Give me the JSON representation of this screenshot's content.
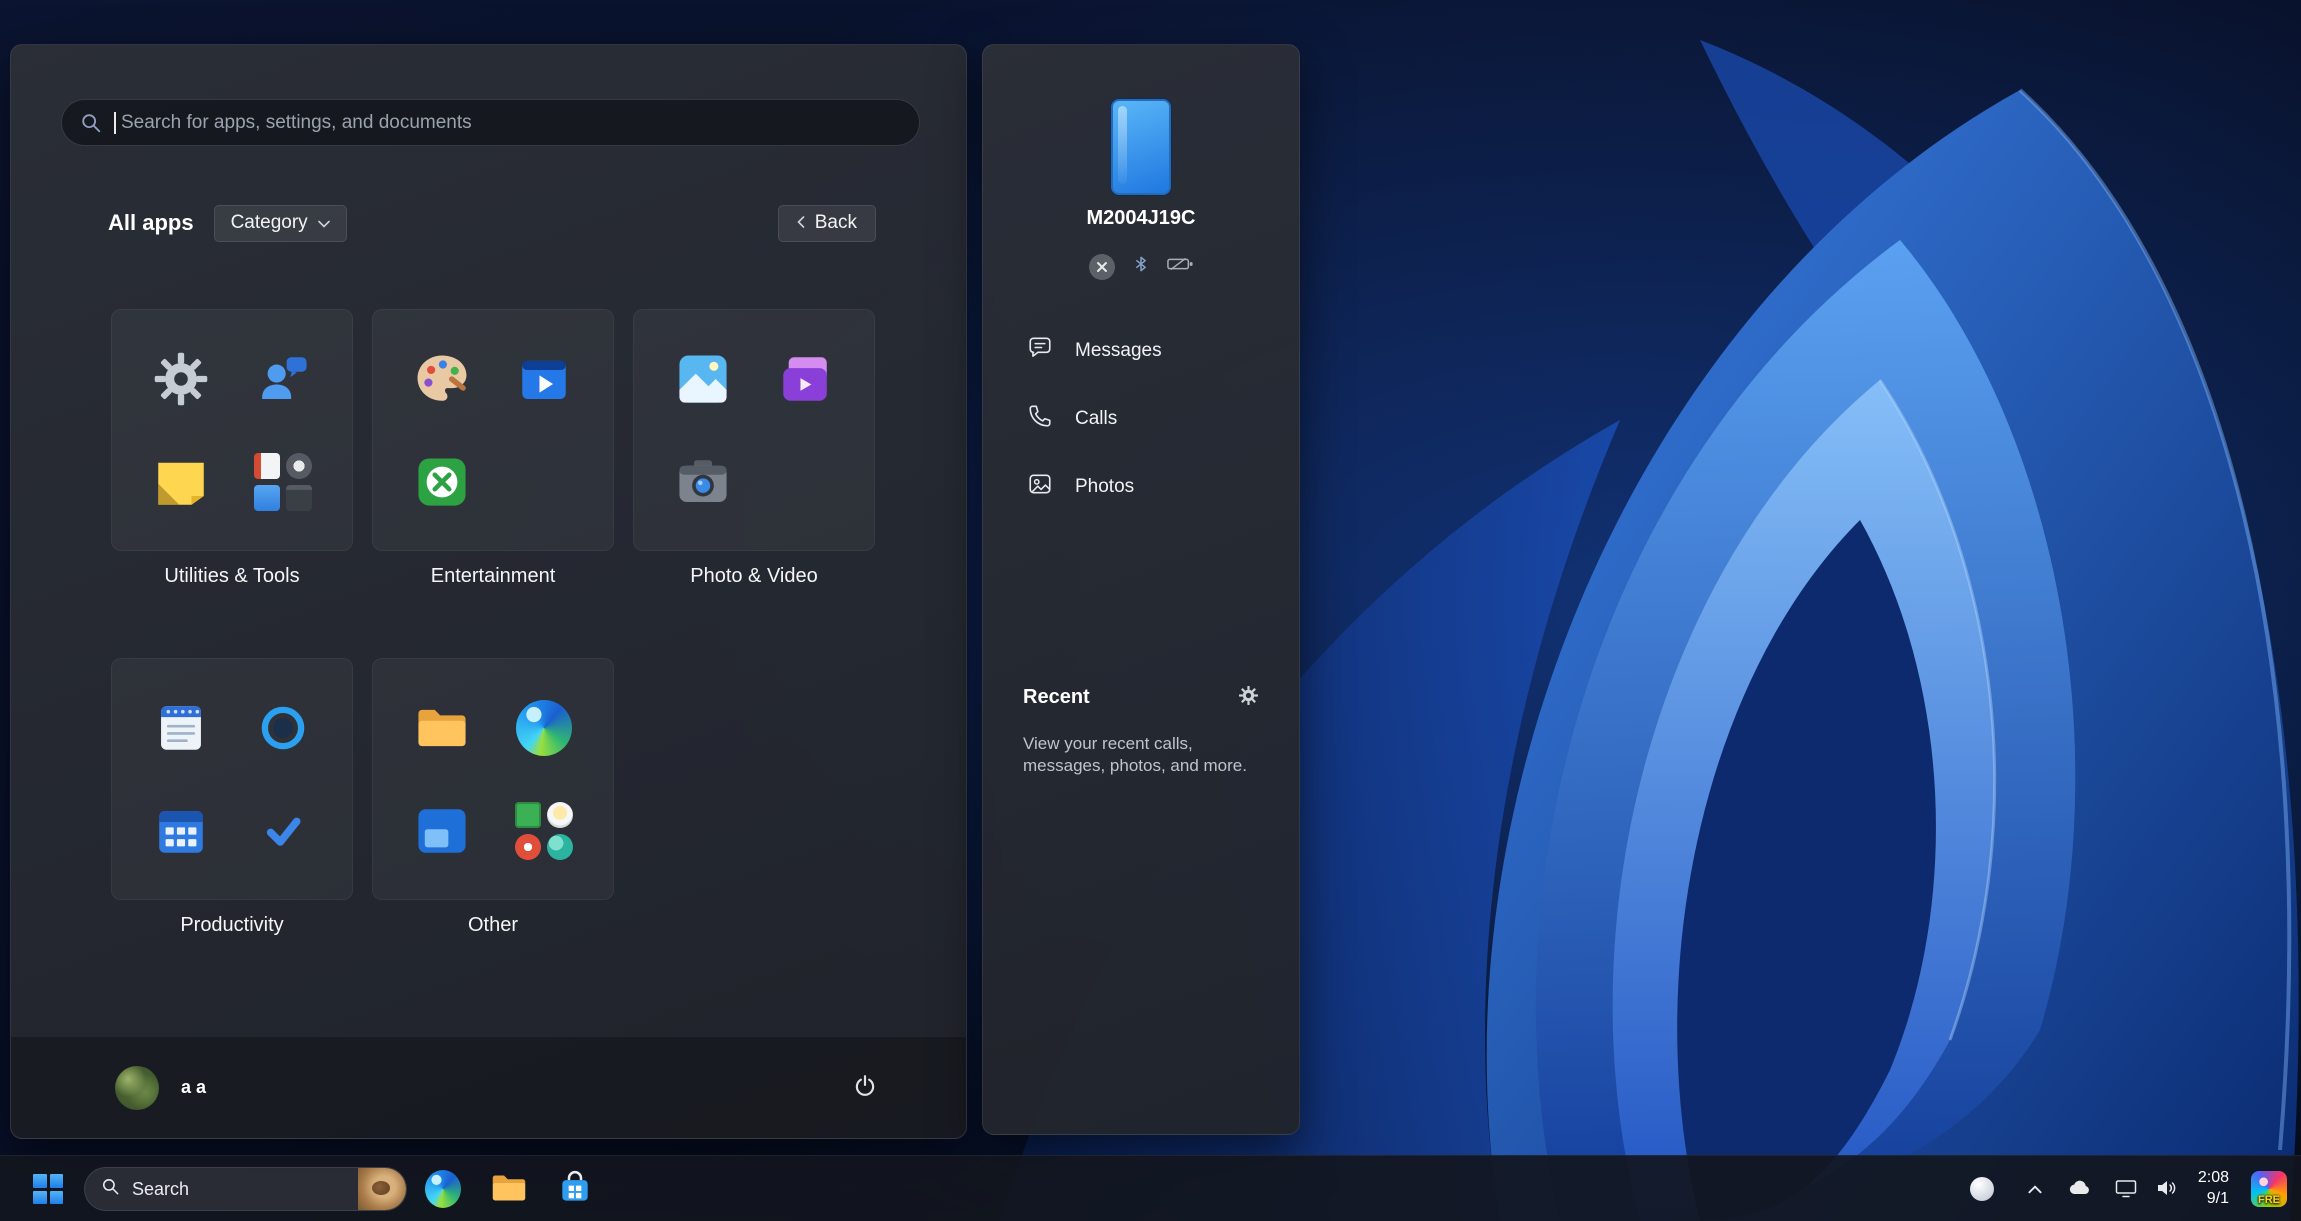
{
  "start_menu": {
    "search_placeholder": "Search for apps, settings, and documents",
    "all_apps_label": "All apps",
    "category_button": "Category",
    "back_button": "Back",
    "categories": [
      {
        "label": "Utilities & Tools",
        "icons": [
          "settings",
          "get-help",
          "sticky-notes",
          "more-utilities-cluster"
        ]
      },
      {
        "label": "Entertainment",
        "icons": [
          "paint",
          "movies-tv",
          "xbox"
        ]
      },
      {
        "label": "Photo & Video",
        "icons": [
          "photos",
          "media-player",
          "camera"
        ]
      },
      {
        "label": "Productivity",
        "icons": [
          "notepad",
          "cortana",
          "calendar",
          "to-do"
        ]
      },
      {
        "label": "Other",
        "icons": [
          "file-explorer",
          "edge",
          "remote-desktop",
          "more-apps-cluster"
        ]
      }
    ],
    "user_name": "a a"
  },
  "phone_link": {
    "device_name": "M2004J19C",
    "status_icons": [
      "disconnected",
      "bluetooth",
      "battery-unknown"
    ],
    "menu": [
      {
        "label": "Messages",
        "icon": "message-bubble"
      },
      {
        "label": "Calls",
        "icon": "phone-handset"
      },
      {
        "label": "Photos",
        "icon": "photo-frame"
      }
    ],
    "recent_title": "Recent",
    "recent_description": "View your recent calls, messages, photos, and more."
  },
  "taskbar": {
    "search_label": "Search",
    "pinned_icons": [
      "edge",
      "file-explorer",
      "microsoft-store"
    ],
    "tray_icons": [
      "copilot",
      "hidden-icons-chevron",
      "onedrive-cloud",
      "network",
      "volume"
    ],
    "time": "2:08",
    "date": "9/1",
    "badge_label": "FRE"
  },
  "accent_colors": {
    "blue": "#2e9df4",
    "panel_bg": "#272b32",
    "wallpaper_blue": "#2458c8"
  }
}
